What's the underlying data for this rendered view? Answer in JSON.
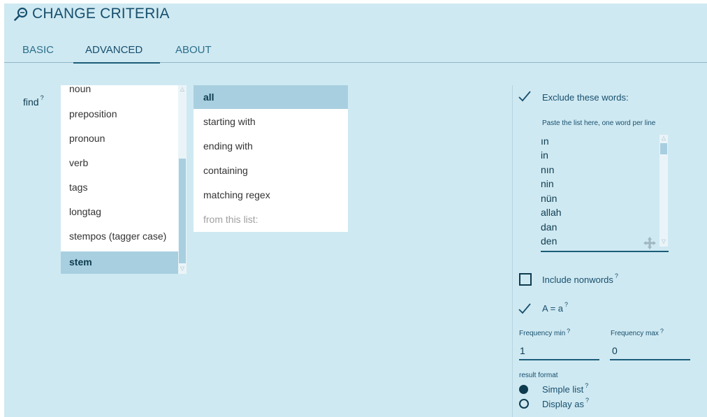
{
  "header": {
    "title": "CHANGE CRITERIA",
    "icon": "search-icon"
  },
  "tabs": [
    {
      "label": "BASIC",
      "active": false
    },
    {
      "label": "ADVANCED",
      "active": true
    },
    {
      "label": "ABOUT",
      "active": false
    }
  ],
  "find": {
    "label": "find",
    "help": "?",
    "options": [
      "noun",
      "preposition",
      "pronoun",
      "verb",
      "tags",
      "longtag",
      "stempos (tagger case)",
      "stem"
    ],
    "selected": "stem"
  },
  "match": {
    "options": [
      "all",
      "starting with",
      "ending with",
      "containing",
      "matching regex",
      "from this list:"
    ],
    "selected": "all"
  },
  "exclude": {
    "checked": true,
    "label": "Exclude these words:",
    "hint": "Paste the list here, one word per line",
    "words": [
      "ın",
      "in",
      "nın",
      "nin",
      "nün",
      "allah",
      "dan",
      "den"
    ]
  },
  "nonwords": {
    "checked": false,
    "label": "Include nonwords",
    "help": "?"
  },
  "case": {
    "checked": true,
    "label": "A = a",
    "help": "?"
  },
  "frequency": {
    "min_label": "Frequency min",
    "min_help": "?",
    "min_value": "1",
    "max_label": "Frequency max",
    "max_help": "?",
    "max_value": "0"
  },
  "result_format": {
    "label": "result format",
    "options": [
      {
        "label": "Simple list",
        "help": "?",
        "selected": true
      },
      {
        "label": "Display as",
        "help": "?",
        "selected": false
      }
    ]
  },
  "colors": {
    "panel": "#cfe9f2",
    "accent": "#1b5d78",
    "selection": "#a8cfdf"
  }
}
